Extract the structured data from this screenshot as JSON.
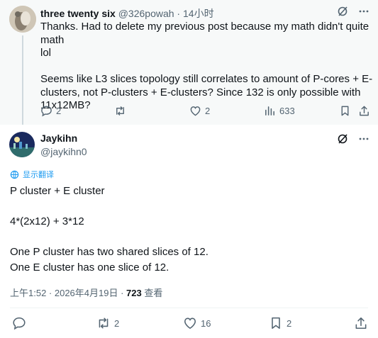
{
  "reply": {
    "author_name": "three twenty six",
    "author_handle": "@326powah",
    "separator": " · ",
    "time": "14小时",
    "body_lines": [
      "Thanks. Had to delete my previous post because my math didn't quite math",
      "lol",
      "",
      "Seems like L3 slices topology still correlates to amount of P-cores + E-",
      "clusters, not P-clusters + E-clusters? Since 132 is only possible with",
      "11x12MB?"
    ],
    "actions": {
      "replies": "2",
      "retweets": "",
      "likes": "2",
      "views": "633"
    }
  },
  "post": {
    "author_name": "Jaykihn",
    "author_handle": "@jaykihn0",
    "translate_label": "显示翻译",
    "lines": [
      "P cluster + E cluster",
      "",
      "4*(2x12) + 3*12",
      "",
      "One P cluster has two shared slices of 12.",
      "One E cluster has one slice of 12."
    ],
    "timestamp": "上午1:52 · 2026年4月19日 · ",
    "views_count": "723",
    "views_label": " 查看",
    "actions": {
      "replies": "",
      "retweets": "2",
      "likes": "16",
      "bookmarks": "2"
    }
  },
  "icons": [
    "grok-icon",
    "more-icon",
    "reply-icon",
    "retweet-icon",
    "like-icon",
    "views-icon",
    "bookmark-icon",
    "share-icon",
    "translate-icon"
  ]
}
